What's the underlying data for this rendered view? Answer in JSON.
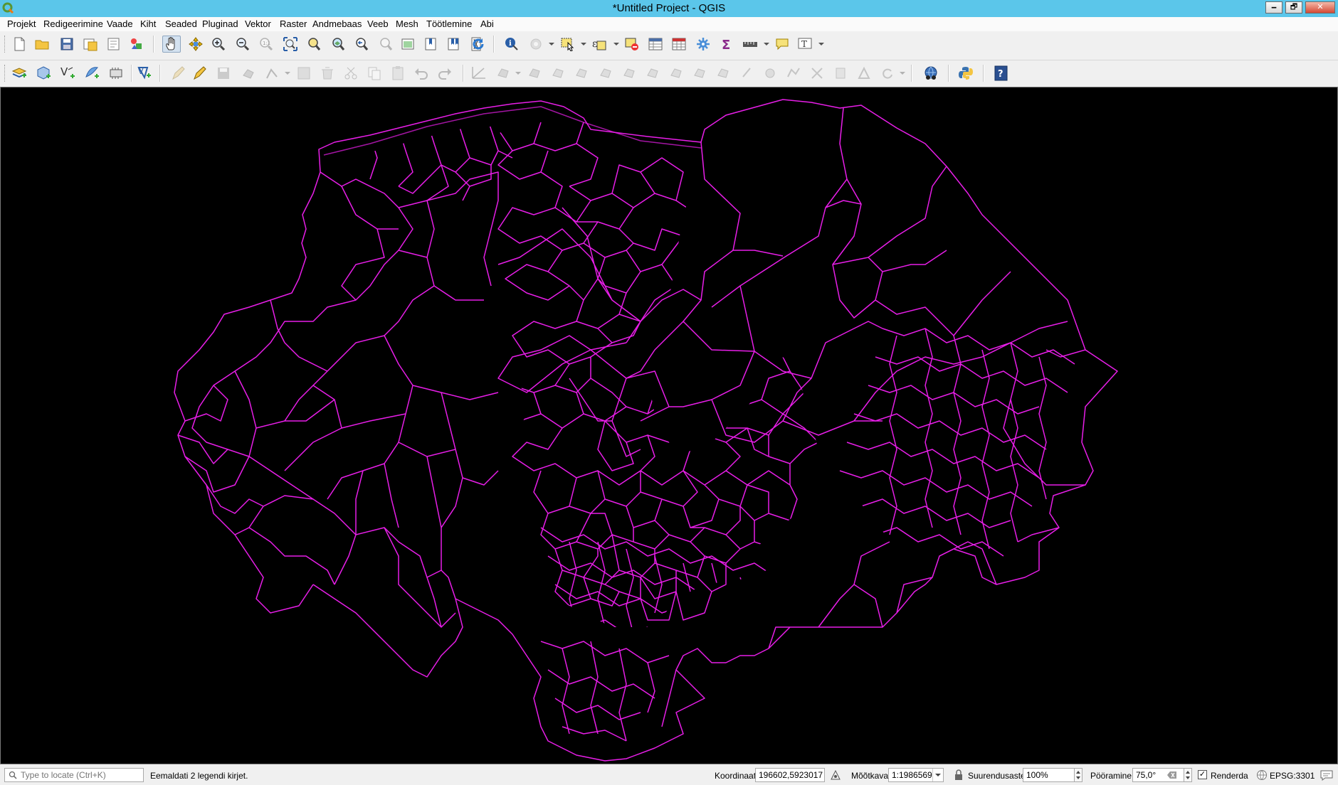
{
  "window": {
    "title": "*Untitled Project - QGIS",
    "minimize_symbol": "🗕",
    "restore_symbol": "🗗",
    "close_symbol": "✕"
  },
  "menubar": {
    "items": [
      {
        "label": "Projekt"
      },
      {
        "label": "Redigeerimine"
      },
      {
        "label": "Vaade"
      },
      {
        "label": "Kiht"
      },
      {
        "label": "Seaded"
      },
      {
        "label": "Pluginad"
      },
      {
        "label": "Vektor"
      },
      {
        "label": "Raster"
      },
      {
        "label": "Andmebaas"
      },
      {
        "label": "Veeb"
      },
      {
        "label": "Mesh"
      },
      {
        "label": "Töötlemine"
      },
      {
        "label": "Abi"
      }
    ]
  },
  "toolbar1": {
    "icons": [
      "new-project-icon",
      "open-project-icon",
      "save-project-icon",
      "save-as-icon",
      "new-print-layout-icon",
      "style-manager-icon",
      "pan-icon",
      "pan-to-selection-icon",
      "zoom-in-icon",
      "zoom-out-icon",
      "zoom-native-icon",
      "zoom-full-icon",
      "zoom-to-selection-icon",
      "zoom-to-layer-icon",
      "zoom-last-icon",
      "zoom-next-icon",
      "new-map-view-icon",
      "new-bookmark-icon",
      "show-bookmarks-icon",
      "temporal-controller-icon",
      "refresh-icon",
      "identify-icon",
      "actions-icon",
      "select-features-icon",
      "select-by-expression-icon",
      "deselect-icon",
      "attribute-table-icon",
      "field-calculator-icon",
      "processing-toolbox-icon",
      "statistics-icon",
      "measure-icon",
      "map-tips-icon",
      "text-annotation-icon"
    ]
  },
  "toolbar2": {
    "icons": [
      "data-source-manager-icon",
      "new-geopackage-layer-icon",
      "new-shapefile-layer-icon",
      "new-spatialite-layer-icon",
      "new-virtual-layer-icon",
      "digitizing-icon",
      "toggle-editing-icon",
      "save-edits-icon",
      "add-feature-icon",
      "vertex-tool-icon",
      "modify-attributes-icon",
      "delete-selected-icon",
      "cut-features-icon",
      "copy-features-icon",
      "paste-features-icon",
      "undo-icon",
      "redo-icon",
      "advanced-digitizing-icon",
      "add-ring-icon",
      "fill-ring-icon",
      "delete-ring-icon",
      "python-console-icon",
      "help-icon"
    ]
  },
  "map": {
    "background": "#000000",
    "feature_color": "#e81ee8",
    "description_layer": "municipal boundaries polygon layer"
  },
  "statusbar": {
    "locator_placeholder": "Type to locate (Ctrl+K)",
    "message": "Eemaldati 2 legendi kirjet.",
    "coordinate_label": "Koordinaat",
    "coordinate_value": "196602,5923017",
    "scale_label": "Mõõtkava",
    "scale_value": "1:1986569",
    "magnifier_label": "Suurendusaste",
    "magnifier_value": "100%",
    "rotation_label": "Pööramine",
    "rotation_value": "75,0°",
    "render_label": "Renderda",
    "render_checked": true,
    "crs_label": "EPSG:3301"
  }
}
